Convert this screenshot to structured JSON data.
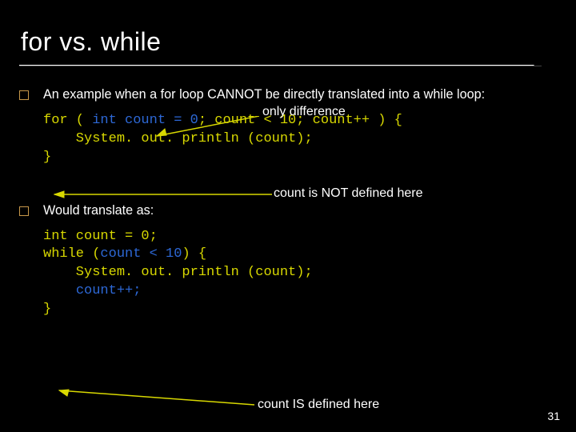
{
  "slide": {
    "title": "for vs. while",
    "bullet1": "An example when a for loop CANNOT be directly translated into a while loop:",
    "ann_only_diff": "only difference",
    "code1": {
      "l1_a": "for ( ",
      "l1_b": "int count = 0",
      "l1_c": "; count < 10; count++ ) {",
      "l2": "    System. out. println (count);",
      "l3": "}"
    },
    "ann_not_defined": "count is NOT defined here",
    "bullet2": "Would translate as:",
    "code2": {
      "l1": "int count = 0;",
      "l2_a": "while (",
      "l2_b": "count < 10",
      "l2_c": ") {",
      "l3": "    System. out. println (count);",
      "l4_a": "    ",
      "l4_b": "count++;",
      "l5": "}"
    },
    "ann_is_defined": "count IS defined here",
    "page": "31"
  }
}
